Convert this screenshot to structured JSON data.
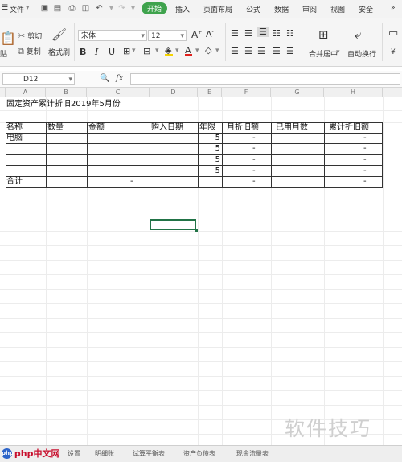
{
  "menubar": {
    "file": "文件",
    "tabs": [
      "开始",
      "插入",
      "页面布局",
      "公式",
      "数据",
      "审阅",
      "视图",
      "安全"
    ],
    "active_tab": "开始"
  },
  "ribbon": {
    "paste": "贴",
    "cut": "剪切",
    "copy": "复制",
    "format_painter": "格式刷",
    "font_name": "宋体",
    "font_size": "12",
    "merge_center": "合并居中",
    "wrap_text": "自动换行"
  },
  "formula_bar": {
    "name_box": "D12",
    "fx_symbol": "fx",
    "content": ""
  },
  "columns": [
    "A",
    "B",
    "C",
    "D",
    "E",
    "F",
    "G",
    "H"
  ],
  "sheet": {
    "title": "固定资产累计折旧2019年5月份",
    "headers": [
      "名称",
      "数量",
      "金额",
      "购入日期",
      "年限",
      "月折旧额",
      "已用月数",
      "累计折旧额"
    ],
    "rows": [
      {
        "name": "电脑",
        "years": "5",
        "monthly": "-",
        "accum": "-"
      },
      {
        "name": "",
        "years": "5",
        "monthly": "-",
        "accum": "-"
      },
      {
        "name": "",
        "years": "5",
        "monthly": "-",
        "accum": "-"
      },
      {
        "name": "",
        "years": "5",
        "monthly": "-",
        "accum": "-"
      }
    ],
    "total": {
      "name": "合计",
      "amount": "-",
      "monthly": "-",
      "accum": "-"
    }
  },
  "sheet_tabs": [
    "设置",
    "明细账",
    "试算平衡表",
    "资产负债表",
    "现金流量表"
  ],
  "watermark": {
    "left_logo": "php中文网",
    "right_text": "软件技巧"
  },
  "colors": {
    "accent": "#3fa34d",
    "selection": "#217346"
  }
}
